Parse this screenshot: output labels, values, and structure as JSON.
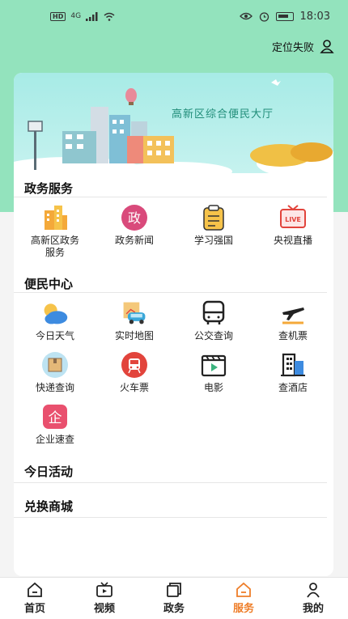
{
  "status_bar": {
    "time": "18:03",
    "network": "4G",
    "hd": "HD"
  },
  "location": {
    "label": "定位失败"
  },
  "banner": {
    "title": "高新区综合便民大厅"
  },
  "sections": {
    "gov": {
      "title": "政务服务",
      "items": [
        {
          "label": "高新区政务服务",
          "icon": "buildings-icon"
        },
        {
          "label": "政务新闻",
          "icon": "zheng-badge-icon"
        },
        {
          "label": "学习强国",
          "icon": "clipboard-icon"
        },
        {
          "label": "央视直播",
          "icon": "live-tv-icon"
        }
      ]
    },
    "life": {
      "title": "便民中心",
      "items": [
        {
          "label": "今日天气",
          "icon": "weather-icon"
        },
        {
          "label": "实时地图",
          "icon": "map-car-icon"
        },
        {
          "label": "公交查询",
          "icon": "bus-icon"
        },
        {
          "label": "查机票",
          "icon": "airplane-icon"
        },
        {
          "label": "快递查询",
          "icon": "package-icon"
        },
        {
          "label": "火车票",
          "icon": "train-icon"
        },
        {
          "label": "电影",
          "icon": "movie-icon"
        },
        {
          "label": "查酒店",
          "icon": "hotel-icon"
        },
        {
          "label": "企业速查",
          "icon": "enterprise-icon"
        }
      ]
    },
    "activity": {
      "title": "今日活动"
    },
    "mall": {
      "title": "兑换商城"
    }
  },
  "tabbar": [
    {
      "label": "首页",
      "icon": "home-icon"
    },
    {
      "label": "视频",
      "icon": "video-icon"
    },
    {
      "label": "政务",
      "icon": "gov-icon"
    },
    {
      "label": "服务",
      "icon": "service-icon",
      "active": true
    },
    {
      "label": "我的",
      "icon": "user-icon"
    }
  ],
  "colors": {
    "accent": "#ee7d28",
    "header_bg": "#93e3bd"
  },
  "zheng_glyph": "政",
  "live_text": "LIVE",
  "qi_glyph": "企"
}
